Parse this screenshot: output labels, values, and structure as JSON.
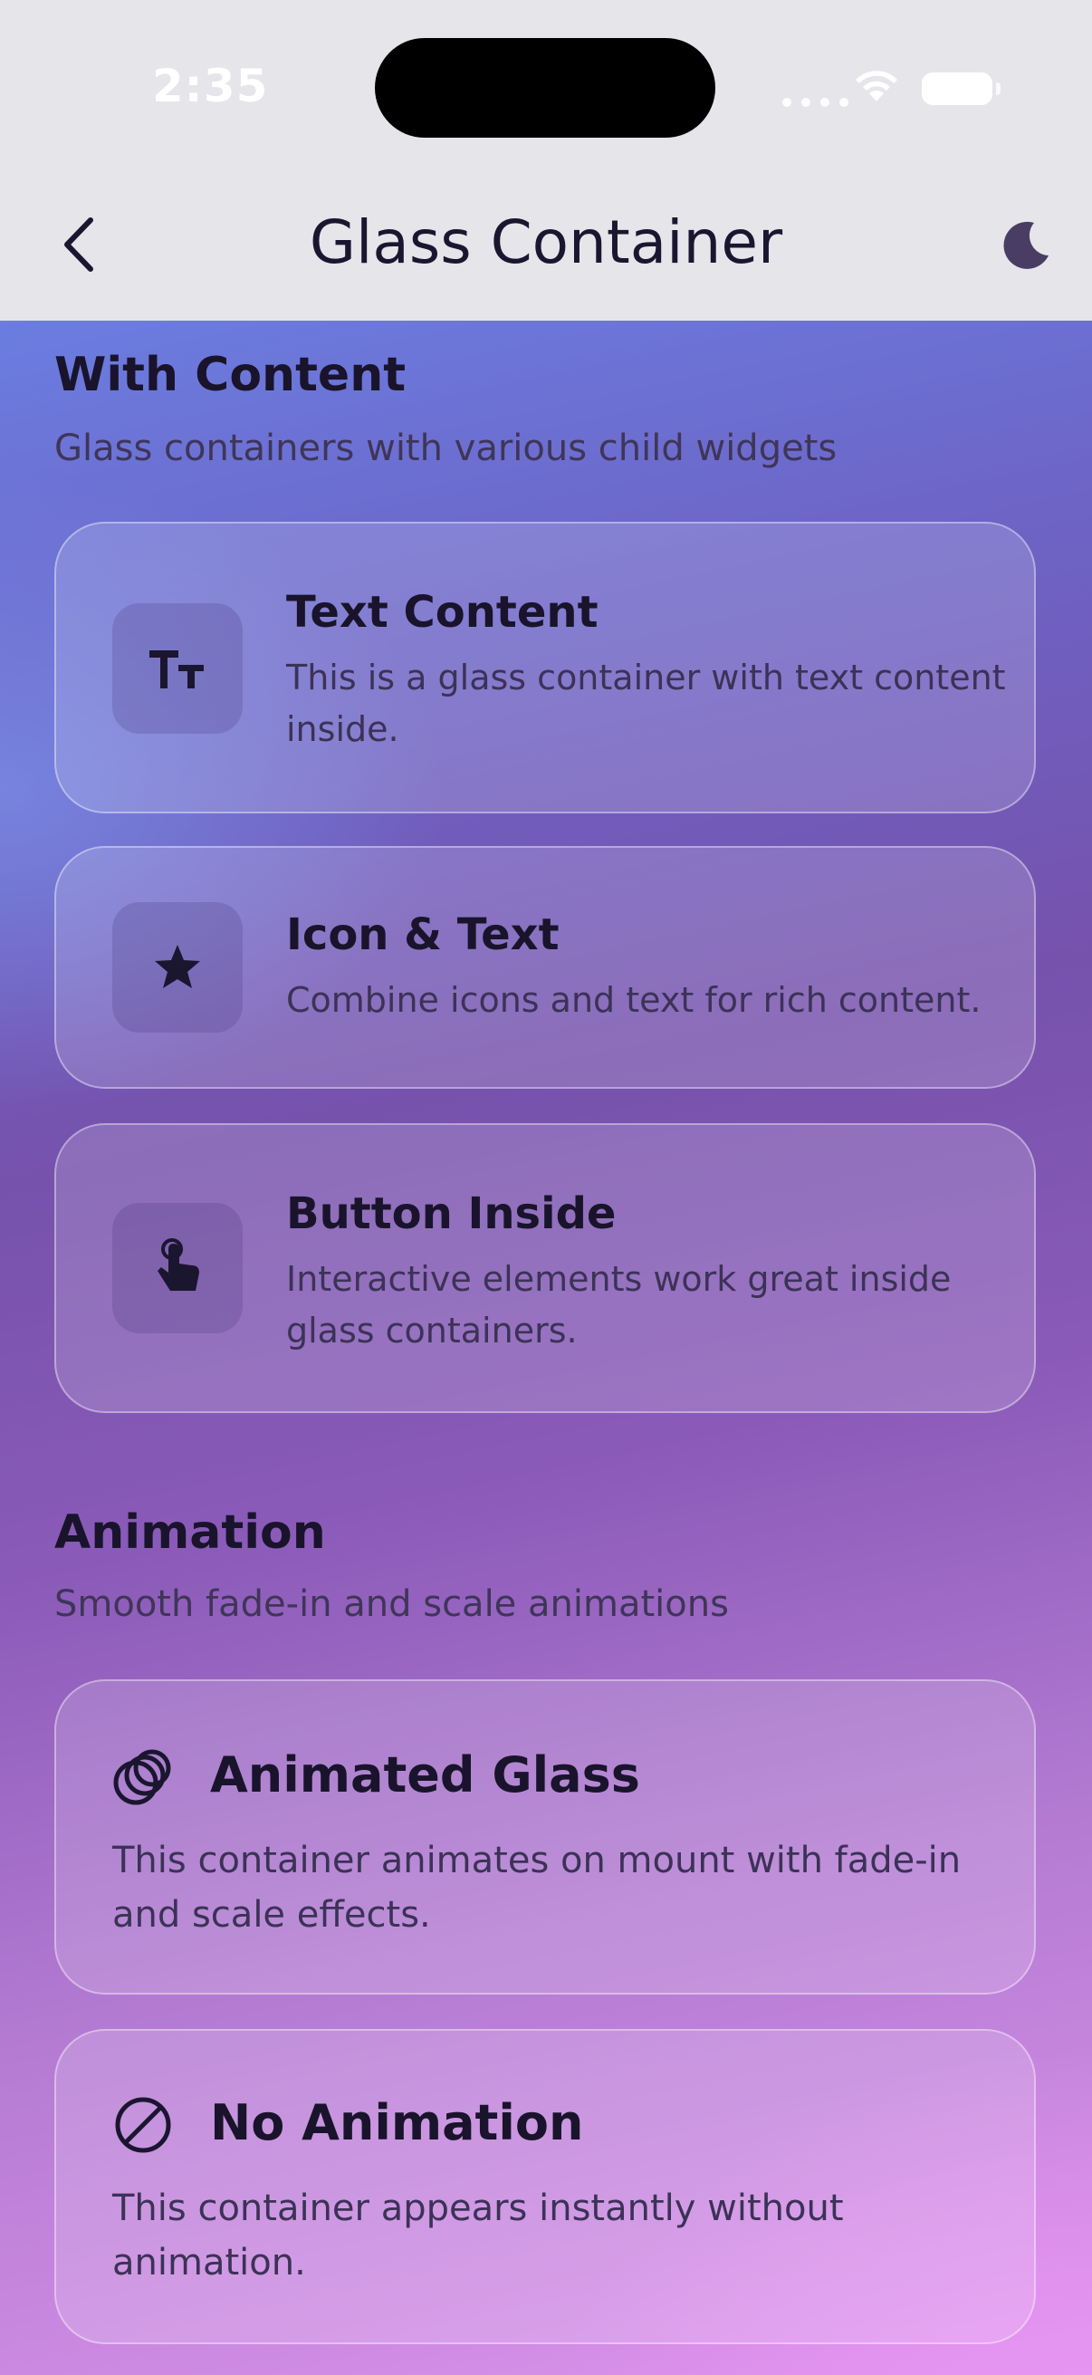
{
  "status_bar": {
    "time": "2:35"
  },
  "nav": {
    "title": "Glass Container",
    "back_icon": "chevron-left-icon",
    "theme_icon": "moon-icon"
  },
  "sections": [
    {
      "title": "With Content",
      "subtitle": "Glass containers with various child widgets",
      "cards": [
        {
          "icon": "text-size-icon",
          "title": "Text Content",
          "desc": "This is a glass container with text content inside."
        },
        {
          "icon": "star-icon",
          "title": "Icon & Text",
          "desc": "Combine icons and text for rich content."
        },
        {
          "icon": "tap-icon",
          "title": "Button Inside",
          "desc": "Interactive elements work great inside glass containers."
        }
      ]
    },
    {
      "title": "Animation",
      "subtitle": "Smooth fade-in and scale animations",
      "cards": [
        {
          "icon": "layers-circles-icon",
          "title": "Animated Glass",
          "desc": "This container animates on mount with fade-in and scale effects."
        },
        {
          "icon": "block-icon",
          "title": "No Animation",
          "desc": "This container appears instantly without animation."
        }
      ]
    }
  ],
  "colors": {
    "nav_bg": "#e6e5ea",
    "gradient_start": "#6b7de0",
    "gradient_end": "#dc93ec",
    "text": "#19142b"
  }
}
